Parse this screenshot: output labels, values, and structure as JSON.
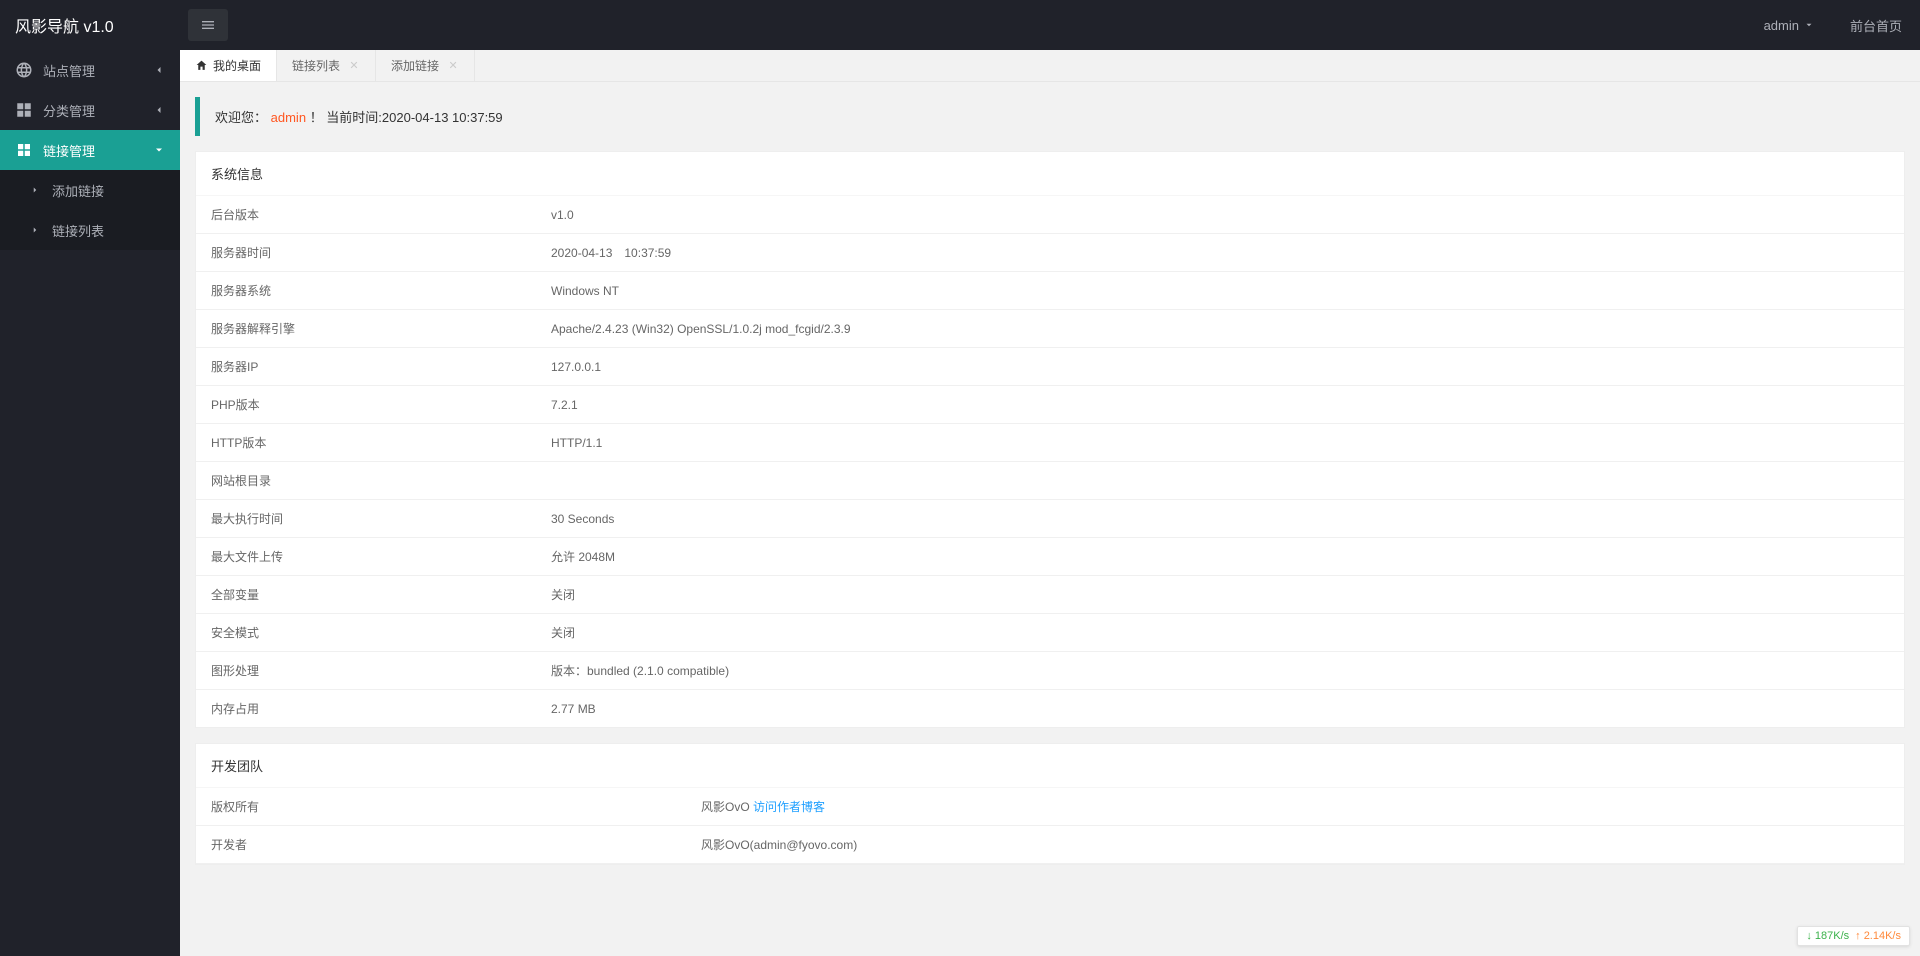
{
  "app": {
    "title": "风影导航 v1.0"
  },
  "header": {
    "user": "admin",
    "front_link": "前台首页"
  },
  "sidebar": {
    "items": [
      {
        "icon": "site",
        "label": "站点管理",
        "active": false,
        "expanded": false
      },
      {
        "icon": "category",
        "label": "分类管理",
        "active": false,
        "expanded": false
      },
      {
        "icon": "link",
        "label": "链接管理",
        "active": true,
        "expanded": true
      }
    ],
    "link_sub": [
      {
        "label": "添加链接"
      },
      {
        "label": "链接列表"
      }
    ]
  },
  "tabs": [
    {
      "label": "我的桌面",
      "closable": false,
      "active": true
    },
    {
      "label": "链接列表",
      "closable": true,
      "active": false
    },
    {
      "label": "添加链接",
      "closable": true,
      "active": false
    }
  ],
  "welcome": {
    "prefix": "欢迎您：",
    "user": "admin",
    "suffix": "！ 当前时间:",
    "time": "2020-04-13 10:37:59"
  },
  "system_info": {
    "title": "系统信息",
    "rows": [
      {
        "label": "后台版本",
        "value": "v1.0"
      },
      {
        "label": "服务器时间",
        "value": "2020-04-13　10:37:59"
      },
      {
        "label": "服务器系统",
        "value": "Windows NT"
      },
      {
        "label": "服务器解释引擎",
        "value": "Apache/2.4.23 (Win32) OpenSSL/1.0.2j mod_fcgid/2.3.9"
      },
      {
        "label": "服务器IP",
        "value": "127.0.0.1"
      },
      {
        "label": "PHP版本",
        "value": "7.2.1"
      },
      {
        "label": "HTTP版本",
        "value": "HTTP/1.1"
      },
      {
        "label": "网站根目录",
        "value": " "
      },
      {
        "label": "最大执行时间",
        "value": "30 Seconds"
      },
      {
        "label": "最大文件上传",
        "value": "允许 2048M"
      },
      {
        "label": "全部变量",
        "value": "关闭"
      },
      {
        "label": "安全模式",
        "value": "关闭"
      },
      {
        "label": "图形处理",
        "value": "版本：bundled (2.1.0 compatible)"
      },
      {
        "label": "内存占用",
        "value": "2.77 MB"
      }
    ]
  },
  "dev_team": {
    "title": "开发团队",
    "rows": [
      {
        "label": "版权所有",
        "value_prefix": "风影OvO ",
        "link": "访问作者博客"
      },
      {
        "label": "开发者",
        "value_prefix": "风影OvO(admin@fyovo.com)",
        "link": ""
      }
    ]
  },
  "net": {
    "down": "187K/s",
    "up": "2.14K/s"
  }
}
